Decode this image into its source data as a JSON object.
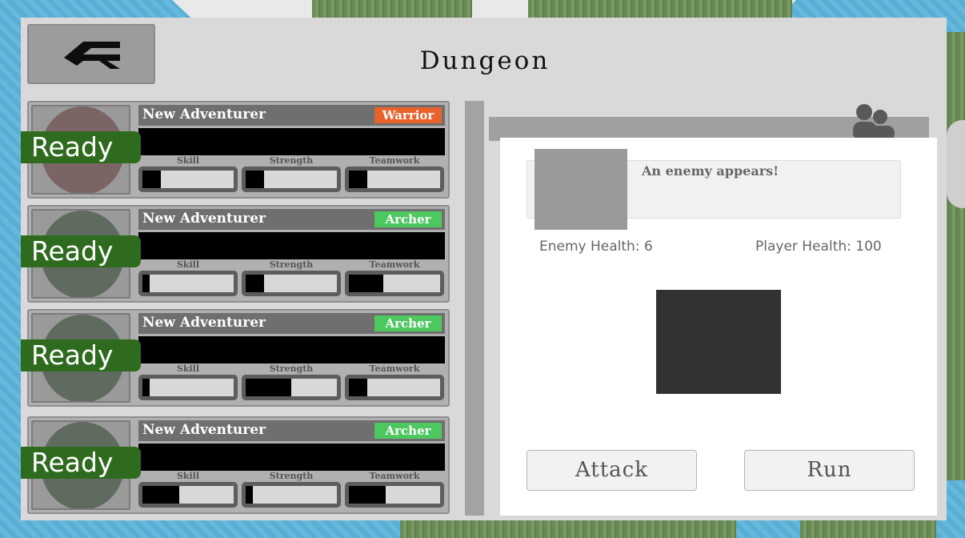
{
  "dungeon": {
    "title": "Dungeon",
    "colors": {
      "panel_bg": "#d9d9d9",
      "ready_green": "#2e6b1e",
      "warrior_badge": "#e8622c",
      "archer_badge": "#4cc85f"
    },
    "adventurers": [
      {
        "name": "New Adventurer",
        "class": "Warrior",
        "status": "Ready",
        "portrait_color": "#7b6464",
        "stats": [
          {
            "label": "Skill",
            "value": 0.2
          },
          {
            "label": "Strength",
            "value": 0.2
          },
          {
            "label": "Teamwork",
            "value": 0.2
          }
        ]
      },
      {
        "name": "New Adventurer",
        "class": "Archer",
        "status": "Ready",
        "portrait_color": "#5f6b5f",
        "stats": [
          {
            "label": "Skill",
            "value": 0.08
          },
          {
            "label": "Strength",
            "value": 0.2
          },
          {
            "label": "Teamwork",
            "value": 0.38
          }
        ]
      },
      {
        "name": "New Adventurer",
        "class": "Archer",
        "status": "Ready",
        "portrait_color": "#5f6b5f",
        "stats": [
          {
            "label": "Skill",
            "value": 0.08
          },
          {
            "label": "Strength",
            "value": 0.5
          },
          {
            "label": "Teamwork",
            "value": 0.2
          }
        ]
      },
      {
        "name": "New Adventurer",
        "class": "Archer",
        "status": "Ready",
        "portrait_color": "#5f6b5f",
        "stats": [
          {
            "label": "Skill",
            "value": 0.4
          },
          {
            "label": "Strength",
            "value": 0.08
          },
          {
            "label": "Teamwork",
            "value": 0.4
          }
        ]
      }
    ],
    "battle": {
      "message": "An enemy appears!",
      "enemy_health_text": "Enemy Health: 6",
      "player_health_text": "Player Health: 100",
      "attack_label": "Attack",
      "run_label": "Run"
    }
  }
}
